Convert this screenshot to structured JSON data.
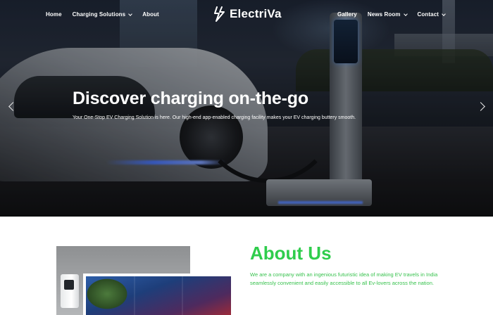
{
  "brand": {
    "name": "ElectriVa",
    "logo_icon": "lightning-bolt-icon"
  },
  "nav": {
    "left": [
      {
        "label": "Home",
        "dropdown": false
      },
      {
        "label": "Charging Solutions",
        "dropdown": true
      },
      {
        "label": "About",
        "dropdown": false
      }
    ],
    "right": [
      {
        "label": "Gallery",
        "dropdown": false
      },
      {
        "label": "News Room",
        "dropdown": true
      },
      {
        "label": "Contact",
        "dropdown": true
      }
    ]
  },
  "hero": {
    "title": "Discover charging on-the-go",
    "subtitle": "Your One-Stop EV Charging Solution is here. Our high-end app-enabled charging facility makes your EV charging buttery smooth.",
    "prev_icon": "chevron-left-icon",
    "next_icon": "chevron-right-icon"
  },
  "about": {
    "title": "About Us",
    "text": "We are a company with an ingenious futuristic idea of making EV travels in India seamlessly convenient and easily accessible to all Ev-lovers across the nation."
  },
  "colors": {
    "accent": "#2fcd4c",
    "nav_text": "#ffffff",
    "background": "#ffffff"
  }
}
